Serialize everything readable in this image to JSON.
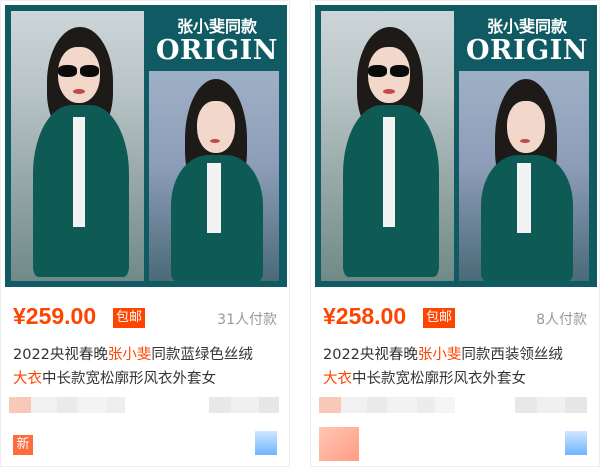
{
  "products": [
    {
      "promo_name": "张小斐同款",
      "promo_brand": "ORIGIN",
      "price": "¥259.00",
      "shipping_badge": "包邮",
      "sold": "31人付款",
      "title_prefix": "2022央视春晚",
      "title_highlight_1": "张小斐",
      "title_mid": "同款蓝绿色丝绒",
      "title_highlight_2": "大衣",
      "title_suffix": "中长款宽松廓形风衣外套女",
      "new_label": "新"
    },
    {
      "promo_name": "张小斐同款",
      "promo_brand": "ORIGIN",
      "price": "¥258.00",
      "shipping_badge": "包邮",
      "sold": "8人付款",
      "title_prefix": "2022央视春晚",
      "title_highlight_1": "张小斐",
      "title_mid": "同款西装领丝绒",
      "title_highlight_2": "大衣",
      "title_suffix": "中长款宽松廓形风衣外套女"
    }
  ],
  "colors": {
    "accent": "#ff4400",
    "thumb_background": "#0f5a63",
    "coat": "#0e5a55",
    "muted_text": "#999999",
    "title_text": "#333333"
  }
}
